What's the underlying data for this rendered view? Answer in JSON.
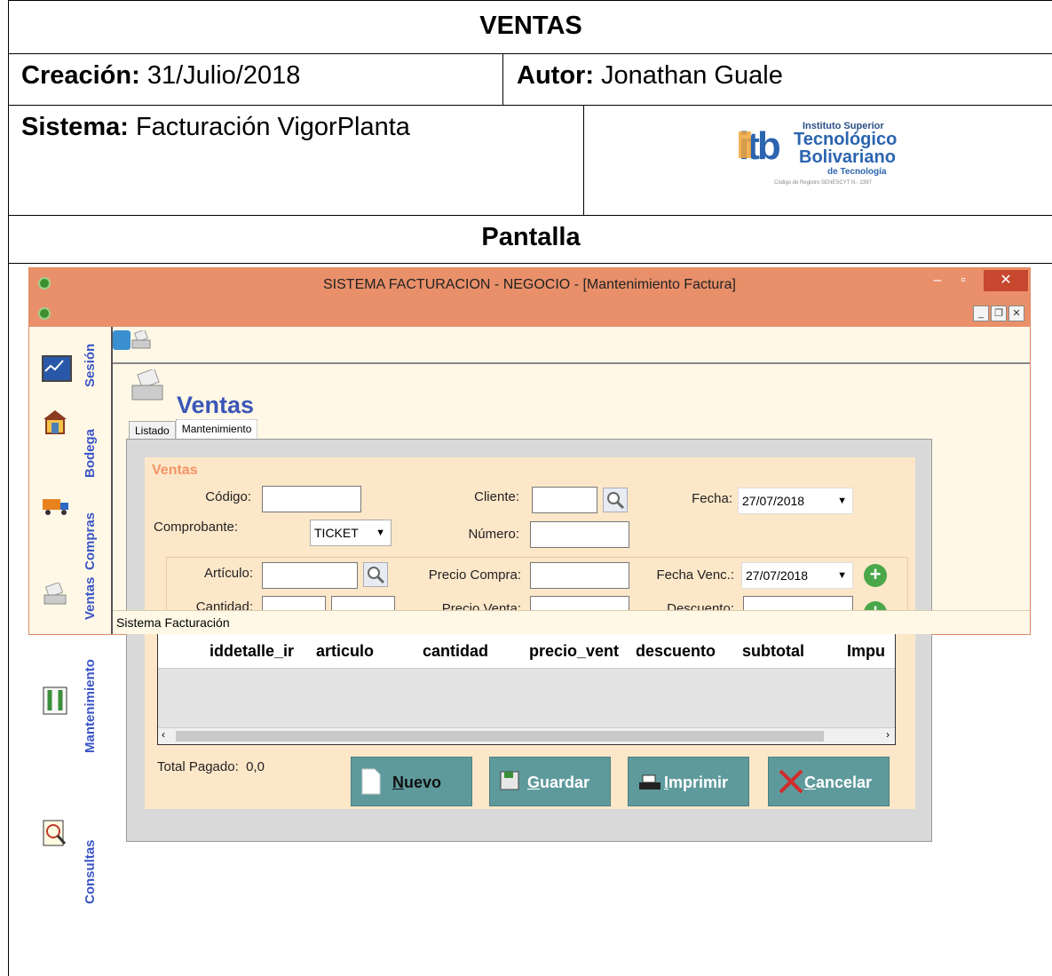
{
  "document": {
    "header": "VENTAS",
    "creacion_label": "Creación:",
    "creacion_value": "31/Julio/2018",
    "autor_label": "Autor:",
    "autor_value": "Jonathan Guale",
    "sistema_label": "Sistema:",
    "sistema_value": "Facturación VigorPlanta",
    "pantalla": "Pantalla",
    "logo": {
      "top": "Instituto Superior",
      "line1": "Tecnológico",
      "line2": "Bolivariano",
      "line3": "de Tecnología",
      "small": "Código de Registro SENESCYT N.- 2397",
      "mark": "itb"
    }
  },
  "window": {
    "title": "SISTEMA FACTURACION - NEGOCIO - [Mantenimiento Factura]",
    "status": "Sistema Facturación",
    "sidebar": [
      "Sesión",
      "Bodega",
      "Compras",
      "Ventas",
      "Mantenimiento",
      "Consultas"
    ]
  },
  "form": {
    "title": "Ventas",
    "tabs": [
      "Listado",
      "Mantenimiento"
    ],
    "group_title": "Ventas",
    "codigo_label": "Código:",
    "codigo_value": "",
    "comprobante_label": "Comprobante:",
    "comprobante_value": "TICKET",
    "cliente_label": "Cliente:",
    "numero_label": "Número:",
    "fecha_label": "Fecha:",
    "fecha_value": "27/07/2018",
    "articulo_label": "Artículo:",
    "cantidad_label": "Cantidad:",
    "precio_compra_label": "Precio Compra:",
    "precio_venta_label": "Precio Venta:",
    "fecha_venc_label": "Fecha Venc.:",
    "fecha_venc_value": "27/07/2018",
    "descuento_label": "Descuento:",
    "grid_columns": [
      "iddetalle_ir",
      "articulo",
      "cantidad",
      "precio_vent",
      "descuento",
      "subtotal",
      "Impu"
    ],
    "total_label": "Total Pagado:",
    "total_value": "0,0",
    "buttons": {
      "nuevo_pre": "N",
      "nuevo_rest": "uevo",
      "guardar_pre": "G",
      "guardar_rest": "uardar",
      "imprimir_pre": "I",
      "imprimir_rest": "mprimir",
      "cancelar_pre": "C",
      "cancelar_rest": "ancelar"
    }
  }
}
